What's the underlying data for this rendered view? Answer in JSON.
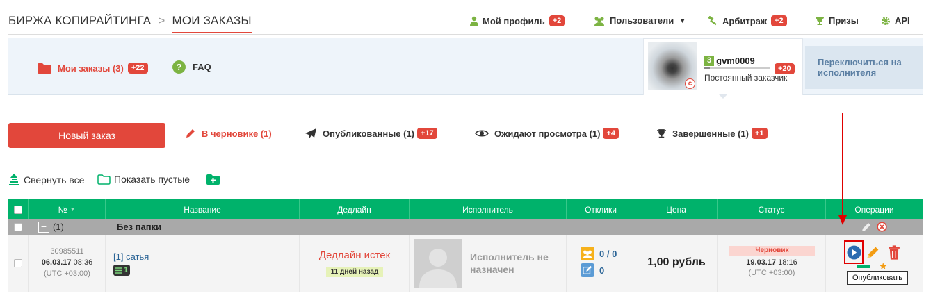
{
  "breadcrumb": {
    "root": "БИРЖА КОПИРАЙТИНГА",
    "separator": ">",
    "current": "МОИ ЗАКАЗЫ"
  },
  "topnav": {
    "profile": {
      "label": "Мой профиль",
      "badge": "+2"
    },
    "users": {
      "label": "Пользователи"
    },
    "arbitrage": {
      "label": "Арбитраж",
      "badge": "+2"
    },
    "prizes": {
      "label": "Призы"
    },
    "api": {
      "label": "API"
    }
  },
  "band": {
    "my_orders": {
      "label": "Мои заказы (3)",
      "badge": "+22"
    },
    "faq": "FAQ",
    "user": {
      "level": "3",
      "name": "gvm0009",
      "badge": "+20",
      "status": "Постоянный заказчик"
    },
    "switch_label": "Переключиться на исполнителя"
  },
  "actions": {
    "new_order": "Новый заказ",
    "tabs": [
      {
        "label": "В черновике (1)"
      },
      {
        "label": "Опубликованные (1)",
        "badge": "+17"
      },
      {
        "label": "Ожидают просмотра (1)",
        "badge": "+4"
      },
      {
        "label": "Завершенные (1)",
        "badge": "+1"
      }
    ]
  },
  "tools": {
    "collapse": "Свернуть все",
    "show_empty": "Показать пустые"
  },
  "table": {
    "headers": [
      "№",
      "Название",
      "Дедлайн",
      "Исполнитель",
      "Отклики",
      "Цена",
      "Статус",
      "Операции"
    ],
    "group": {
      "count": "(1)",
      "name": "Без папки"
    },
    "row": {
      "id": "30985511",
      "date": "06.03.17",
      "time": "08:36",
      "tz": "(UTC +03:00)",
      "title": "[1] сатья",
      "chip": "1",
      "deadline": "Дедлайн истек",
      "deadline_note": "11 дней назад",
      "executor": "Исполнитель не назначен",
      "responses": "0 / 0",
      "comments": "0",
      "price": "1,00 рубль",
      "status": "Черновик",
      "status_date": "19.03.17",
      "status_time": "18:16",
      "status_tz": "(UTC +03:00)"
    },
    "tooltip": "Опубликовать"
  },
  "colors": {
    "accent": "#e2473b",
    "green": "#00b26b",
    "link": "#2a6496"
  }
}
